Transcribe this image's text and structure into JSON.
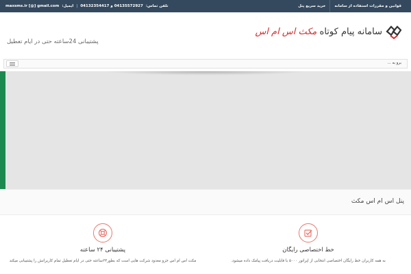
{
  "topbar": {
    "links": [
      {
        "label": "قوانین و مقررات استفاده از سامانه"
      },
      {
        "label": "خرید سریع پنل"
      }
    ],
    "phone_label": "تلفن تماس:",
    "phone_numbers": "04135572927 و 04132354417",
    "email_label": "ایمیل:",
    "email_value": "maxsms.ir [@] gmail.com",
    "separator": "|"
  },
  "header": {
    "logo_text_main": "سامانه پیام کوتاه",
    "logo_text_brand": "مکث اس ام اس",
    "tagline": "پشتیبانی 24ساعته حتی در ایام تعطیل"
  },
  "navbar": {
    "item": "برو به ..."
  },
  "panel": {
    "title": "پنل اس ام اس مکث"
  },
  "features": [
    {
      "title": "خط اختصاصی رایگان",
      "description": "به همه کاربران خط رایگان اختصاصی انتخابی از اپراتور ۵۰۰۰ با قابلیت دریافت پیامک داده میشود.",
      "icon": "check-square-icon"
    },
    {
      "title": "پشتیبانی ۲۴ ساعته",
      "description": "مکث اس ام اس جزو معدود شرکت هایی است که بطور۲۴ساعته حتی در ایام تعطیل تمام کاربرانش را پشتیبانی میکند",
      "icon": "lifebuoy-icon"
    }
  ],
  "colors": {
    "topbar": "#34495e",
    "brand_red": "#d42a2a",
    "slider_accent": "#1c8a4f",
    "icon_ring": "#e8776e"
  }
}
